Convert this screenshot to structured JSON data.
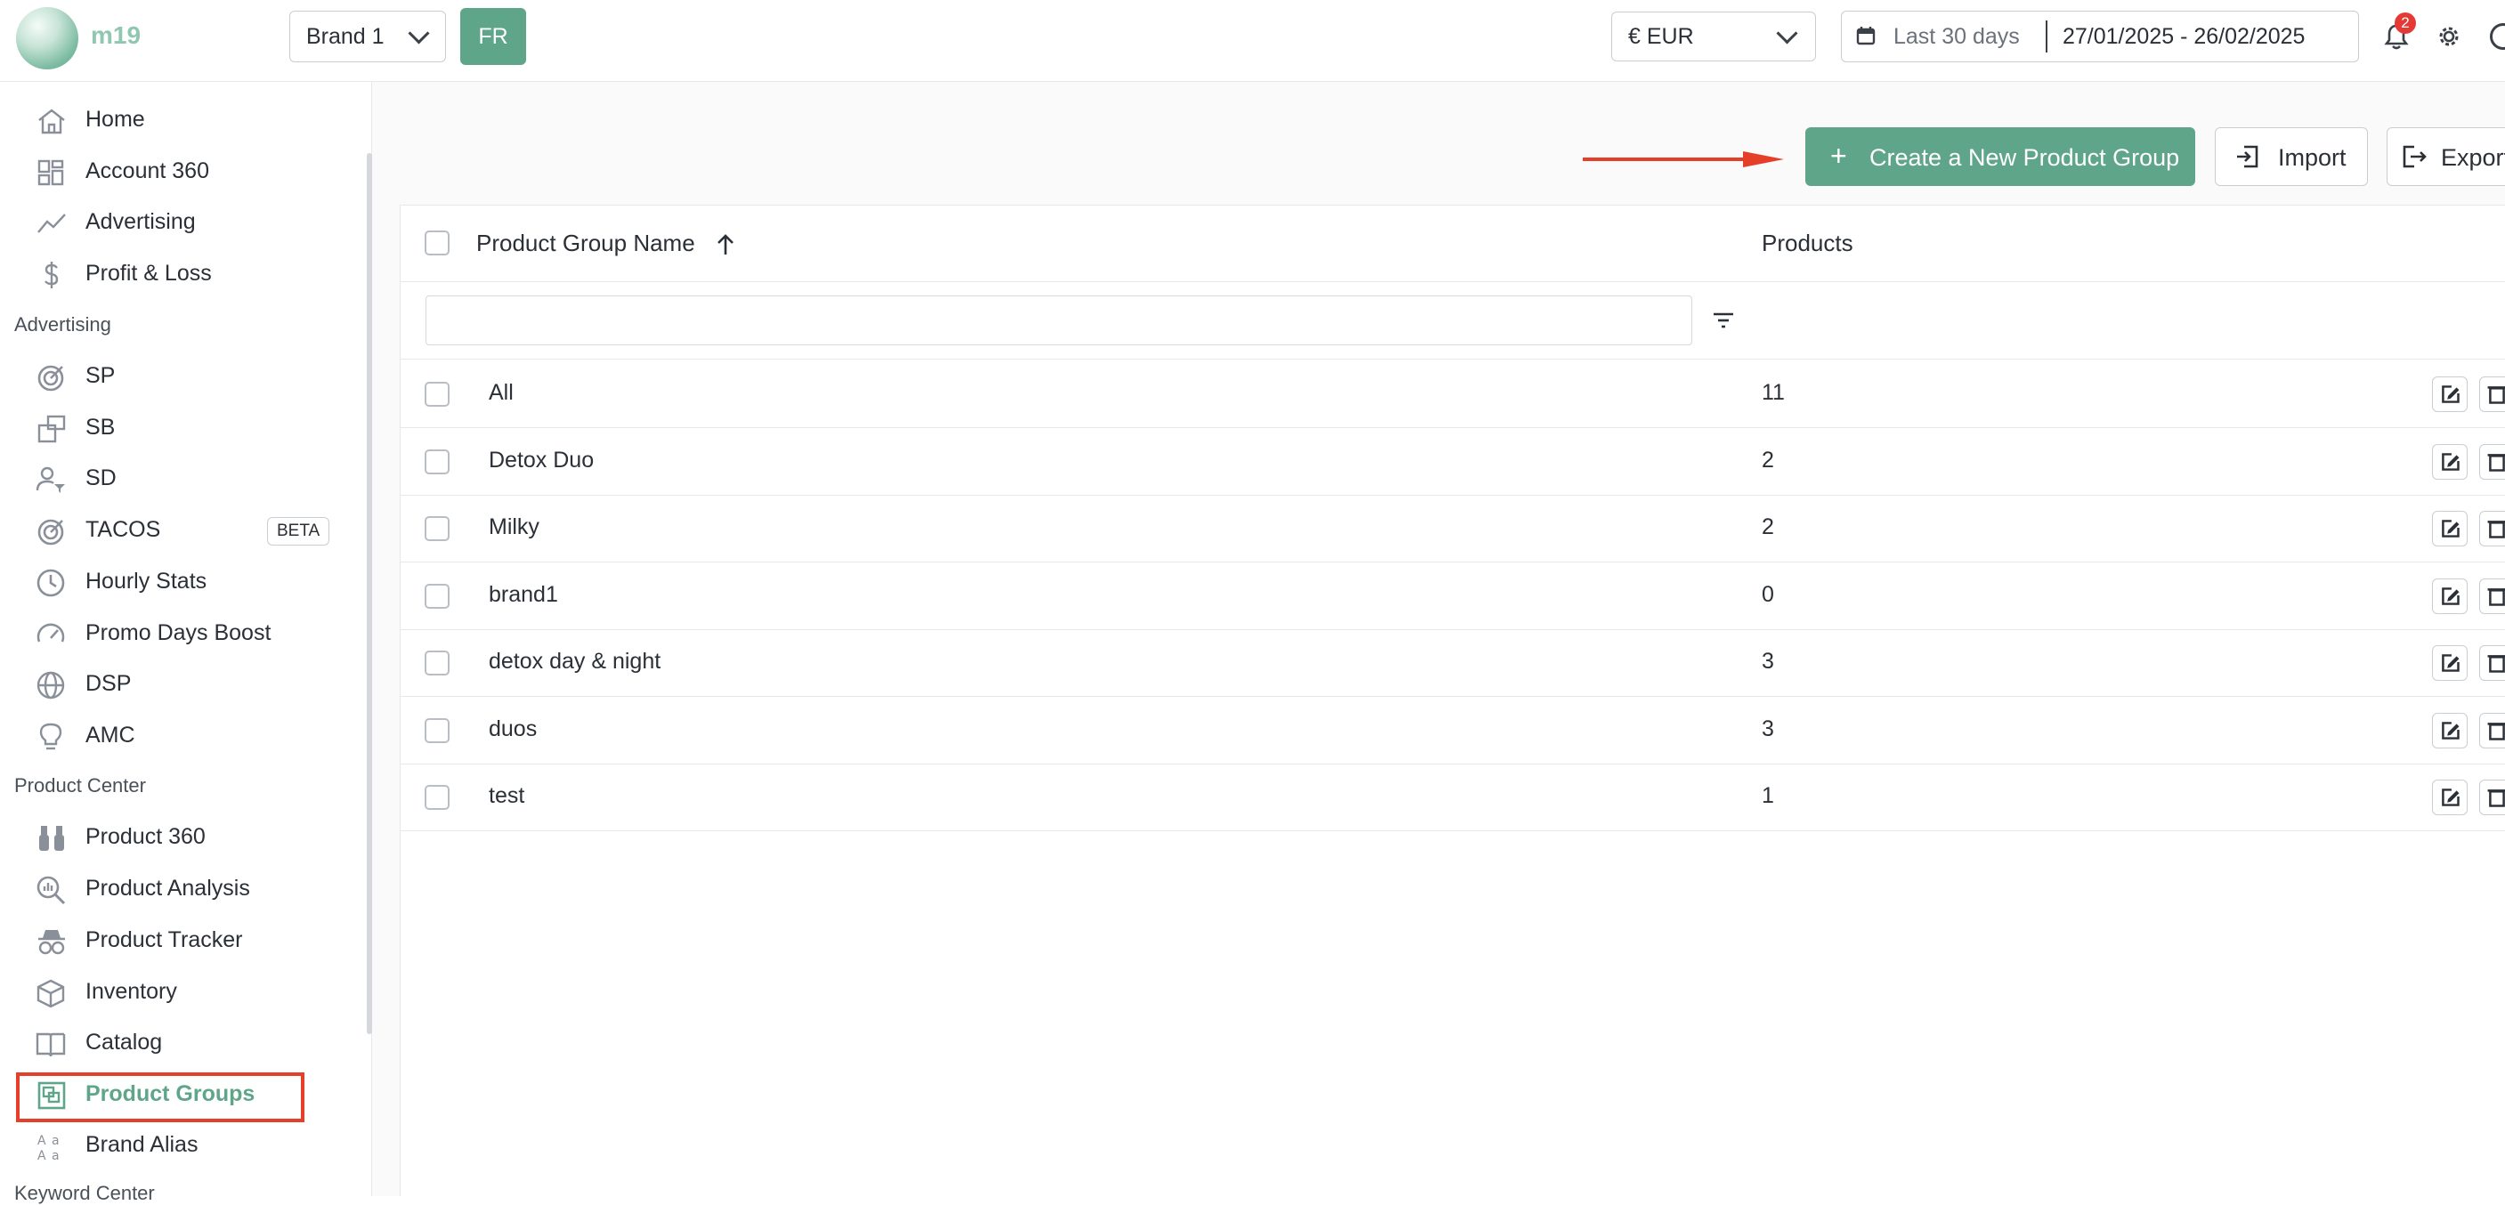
{
  "header": {
    "logo_text": "m19",
    "brand_select": "Brand 1",
    "marketplace": "FR",
    "currency": "€ EUR",
    "date_preset": "Last 30 days",
    "date_range": "27/01/2025 - 26/02/2025",
    "notification_count": "2"
  },
  "sidebar": {
    "main_items": [
      {
        "label": "Home",
        "icon": "home-icon"
      },
      {
        "label": "Account 360",
        "icon": "dashboard-icon"
      },
      {
        "label": "Advertising",
        "icon": "trend-line-icon"
      },
      {
        "label": "Profit & Loss",
        "icon": "dollar-icon"
      }
    ],
    "advertising_section": "Advertising",
    "advertising_items": [
      {
        "label": "SP",
        "icon": "target-icon"
      },
      {
        "label": "SB",
        "icon": "sb-display-icon"
      },
      {
        "label": "SD",
        "icon": "user-filter-icon"
      },
      {
        "label": "TACOS",
        "icon": "target-icon",
        "badge": "BETA"
      },
      {
        "label": "Hourly Stats",
        "icon": "clock-icon"
      },
      {
        "label": "Promo Days Boost",
        "icon": "gauge-icon"
      },
      {
        "label": "DSP",
        "icon": "globe-icon"
      },
      {
        "label": "AMC",
        "icon": "lightbulb-icon"
      }
    ],
    "product_section": "Product Center",
    "product_items": [
      {
        "label": "Product 360",
        "icon": "binoculars-icon"
      },
      {
        "label": "Product Analysis",
        "icon": "magnifier-chart-icon"
      },
      {
        "label": "Product Tracker",
        "icon": "spy-icon"
      },
      {
        "label": "Inventory",
        "icon": "box-icon"
      },
      {
        "label": "Catalog",
        "icon": "book-icon"
      },
      {
        "label": "Product Groups",
        "icon": "group-icon",
        "active": true
      },
      {
        "label": "Brand Alias",
        "icon": "alias-icon"
      }
    ],
    "keyword_section": "Keyword Center"
  },
  "toolbar": {
    "create_label": "Create a New Product Group",
    "import_label": "Import",
    "export_label": "Export"
  },
  "table": {
    "columns": [
      "Product Group Name",
      "Products"
    ],
    "filter_placeholder": "",
    "rows": [
      {
        "name": "All",
        "products": "11"
      },
      {
        "name": "Detox Duo",
        "products": "2"
      },
      {
        "name": "Milky",
        "products": "2"
      },
      {
        "name": "brand1",
        "products": "0"
      },
      {
        "name": "detox day & night",
        "products": "3"
      },
      {
        "name": "duos",
        "products": "3"
      },
      {
        "name": "test",
        "products": "1"
      }
    ]
  },
  "colors": {
    "accent": "#5fa58a",
    "annotation": "#e53f2a",
    "notification": "#e53935"
  }
}
